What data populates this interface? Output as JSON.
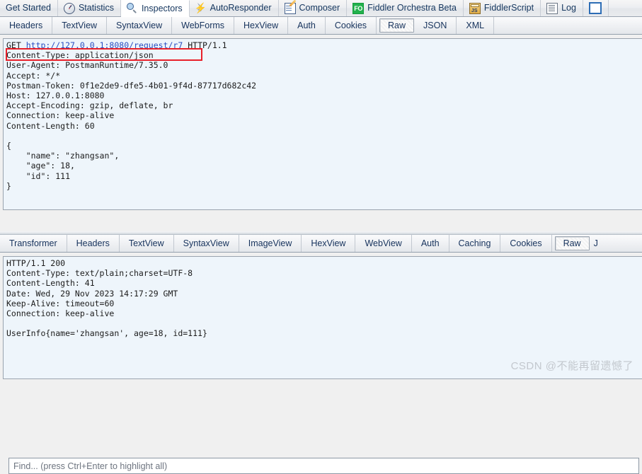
{
  "main_toolbar": {
    "tabs": [
      {
        "label": "Get Started",
        "icon": "none",
        "active": false
      },
      {
        "label": "Statistics",
        "icon": "clock-icon",
        "active": false
      },
      {
        "label": "Inspectors",
        "icon": "magnifier-icon",
        "active": true
      },
      {
        "label": "AutoResponder",
        "icon": "lightning-bolt-icon",
        "active": false
      },
      {
        "label": "Composer",
        "icon": "compose-pencil-icon",
        "active": false
      },
      {
        "label": "Fiddler Orchestra Beta",
        "icon": "fo-badge-icon",
        "active": false
      },
      {
        "label": "FiddlerScript",
        "icon": "script-js-icon",
        "active": false
      },
      {
        "label": "Log",
        "icon": "log-document-icon",
        "active": false
      }
    ],
    "trailing_icon": "filter-checkbox-icon"
  },
  "request": {
    "tabs": [
      {
        "label": "Headers",
        "selected": false
      },
      {
        "label": "TextView",
        "selected": false
      },
      {
        "label": "SyntaxView",
        "selected": false
      },
      {
        "label": "WebForms",
        "selected": false
      },
      {
        "label": "HexView",
        "selected": false
      },
      {
        "label": "Auth",
        "selected": false
      },
      {
        "label": "Cookies",
        "selected": false
      },
      {
        "label": "Raw",
        "selected": true
      },
      {
        "label": "JSON",
        "selected": false
      },
      {
        "label": "XML",
        "selected": false
      }
    ],
    "request_line": {
      "method": "GET",
      "url": "http://127.0.0.1:8080/request/r7",
      "version": "HTTP/1.1"
    },
    "headers_text": "Content-Type: application/json\nUser-Agent: PostmanRuntime/7.35.0\nAccept: */*\nPostman-Token: 0f1e2de9-dfe5-4b01-9f4d-87717d682c42\nHost: 127.0.0.1:8080\nAccept-Encoding: gzip, deflate, br\nConnection: keep-alive\nContent-Length: 60",
    "body_text": "{\n    \"name\": \"zhangsan\",\n    \"age\": 18,\n    \"id\": 111\n}",
    "highlighted_line": "Content-Type: application/json",
    "highlight_color": "#e8202a",
    "find_placeholder": "Find... (press Ctrl+Enter to highlight all)"
  },
  "response": {
    "tabs": [
      {
        "label": "Transformer",
        "selected": false
      },
      {
        "label": "Headers",
        "selected": false
      },
      {
        "label": "TextView",
        "selected": false
      },
      {
        "label": "SyntaxView",
        "selected": false
      },
      {
        "label": "ImageView",
        "selected": false
      },
      {
        "label": "HexView",
        "selected": false
      },
      {
        "label": "WebView",
        "selected": false
      },
      {
        "label": "Auth",
        "selected": false
      },
      {
        "label": "Caching",
        "selected": false
      },
      {
        "label": "Cookies",
        "selected": false
      },
      {
        "label": "Raw",
        "selected": true
      },
      {
        "label": "J",
        "selected": false
      }
    ],
    "raw_text": "HTTP/1.1 200\nContent-Type: text/plain;charset=UTF-8\nContent-Length: 41\nDate: Wed, 29 Nov 2023 14:17:29 GMT\nKeep-Alive: timeout=60\nConnection: keep-alive\n\nUserInfo{name='zhangsan', age=18, id=111}"
  },
  "watermark": {
    "text": "CSDN @不能再留遗憾了"
  }
}
